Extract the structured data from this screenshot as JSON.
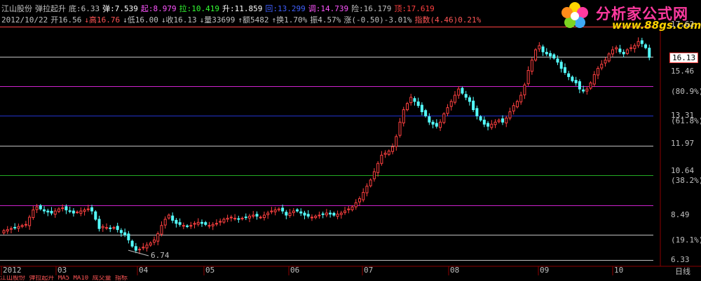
{
  "header": {
    "line1": [
      {
        "text": "江山股份",
        "color": "#c0c0c0"
      },
      {
        "text": "弹拉起升",
        "color": "#c0c0c0"
      },
      {
        "text": "底:6.33",
        "color": "#c0c0c0"
      },
      {
        "text": "弹:7.539",
        "color": "#ffffff"
      },
      {
        "text": "起:8.979",
        "color": "#ff55ff"
      },
      {
        "text": "拉:10.419",
        "color": "#33ff33"
      },
      {
        "text": "升:11.859",
        "color": "#ffffff"
      },
      {
        "text": "回:13.299",
        "color": "#4060ff"
      },
      {
        "text": "调:14.739",
        "color": "#ff55ff"
      },
      {
        "text": "险:16.179",
        "color": "#c0c0c0"
      },
      {
        "text": "顶:17.619",
        "color": "#ff4040"
      }
    ],
    "line2": [
      {
        "text": "2012/10/22",
        "color": "#c0c0c0"
      },
      {
        "text": "开16.56",
        "color": "#c0c0c0"
      },
      {
        "text": "↓高16.76",
        "color": "#ff5555"
      },
      {
        "text": "↓低16.00",
        "color": "#c0c0c0"
      },
      {
        "text": "↓收16.13",
        "color": "#c0c0c0"
      },
      {
        "text": "↓量33699",
        "color": "#c0c0c0"
      },
      {
        "text": "↑额5482",
        "color": "#c0c0c0"
      },
      {
        "text": "↑换1.70%",
        "color": "#c0c0c0"
      },
      {
        "text": "振4.57%",
        "color": "#c0c0c0"
      },
      {
        "text": "涨(-0.50)-3.01%",
        "color": "#c0c0c0"
      },
      {
        "text": "指数(4.46)0.21%",
        "color": "#ff5555"
      }
    ]
  },
  "logo": {
    "title": "分析家公式网",
    "site": "www.88gs.com"
  },
  "price_axis": [
    {
      "label": "17.62",
      "color": "#c0c0c0"
    },
    {
      "label": "16.13",
      "color": "#ffffff",
      "highlight": true
    },
    {
      "label": "15.46",
      "color": "#c0c0c0"
    },
    {
      "label": "(80.9%)",
      "color": "#c0c0c0"
    },
    {
      "label": "13.31",
      "color": "#c0c0c0"
    },
    {
      "label": "(61.8%)",
      "color": "#c0c0c0"
    },
    {
      "label": "11.97",
      "color": "#c0c0c0"
    },
    {
      "label": "10.64",
      "color": "#c0c0c0"
    },
    {
      "label": "(38.2%)",
      "color": "#c0c0c0"
    },
    {
      "label": "8.49",
      "color": "#c0c0c0"
    },
    {
      "label": "(19.1%)",
      "color": "#c0c0c0"
    },
    {
      "label": "6.33",
      "color": "#c0c0c0"
    }
  ],
  "levels": [
    {
      "name": "顶",
      "value": 17.619,
      "color": "#ff4040"
    },
    {
      "name": "险",
      "value": 16.179,
      "color": "#c0c0c0"
    },
    {
      "name": "调",
      "value": 14.739,
      "color": "#cc22cc"
    },
    {
      "name": "回",
      "value": 13.299,
      "color": "#2233cc"
    },
    {
      "name": "升",
      "value": 11.859,
      "color": "#c0c0c0"
    },
    {
      "name": "拉",
      "value": 10.419,
      "color": "#22aa22"
    },
    {
      "name": "起",
      "value": 8.979,
      "color": "#cc22cc"
    },
    {
      "name": "弹",
      "value": 7.539,
      "color": "#c0c0c0"
    },
    {
      "name": "底",
      "value": 6.33,
      "color": "#c0c0c0"
    }
  ],
  "low_marker": "6.74",
  "x_axis": {
    "ticks": [
      "2012",
      "03",
      "04",
      "05",
      "06",
      "07",
      "08",
      "09",
      "10"
    ],
    "period": "日线"
  },
  "chart_data": {
    "type": "candlestick",
    "y_range": [
      6.33,
      17.62
    ],
    "close": [
      7.75,
      7.8,
      7.85,
      7.9,
      7.95,
      8.0,
      8.05,
      8.4,
      8.75,
      8.9,
      8.8,
      8.7,
      8.65,
      8.6,
      8.7,
      8.8,
      8.85,
      8.75,
      8.7,
      8.6,
      8.65,
      8.7,
      8.75,
      8.8,
      8.7,
      8.3,
      7.85,
      7.95,
      7.9,
      7.85,
      7.9,
      7.8,
      7.65,
      7.55,
      7.3,
      7.0,
      6.8,
      6.85,
      6.95,
      7.05,
      7.15,
      7.3,
      7.6,
      8.0,
      8.3,
      8.5,
      8.25,
      8.1,
      8.05,
      8.0,
      7.95,
      8.0,
      8.1,
      8.15,
      8.1,
      8.05,
      8.0,
      8.05,
      8.1,
      8.2,
      8.3,
      8.35,
      8.4,
      8.35,
      8.3,
      8.35,
      8.4,
      8.45,
      8.5,
      8.45,
      8.4,
      8.5,
      8.6,
      8.7,
      8.75,
      8.8,
      8.7,
      8.5,
      8.6,
      8.7,
      8.7,
      8.6,
      8.5,
      8.45,
      8.4,
      8.45,
      8.5,
      8.55,
      8.6,
      8.55,
      8.5,
      8.55,
      8.6,
      8.7,
      8.8,
      8.9,
      9.1,
      9.3,
      9.6,
      9.9,
      10.2,
      10.6,
      11.0,
      11.4,
      11.5,
      11.6,
      11.8,
      12.3,
      13.0,
      13.6,
      13.9,
      14.2,
      14.0,
      13.8,
      13.5,
      13.3,
      13.0,
      12.9,
      12.8,
      13.0,
      13.4,
      13.7,
      14.0,
      14.3,
      14.6,
      14.4,
      14.2,
      14.0,
      13.6,
      13.3,
      13.1,
      12.9,
      12.8,
      12.9,
      13.0,
      13.1,
      13.0,
      13.2,
      13.5,
      13.8,
      14.0,
      14.3,
      14.8,
      15.5,
      16.0,
      16.5,
      16.7,
      16.4,
      16.3,
      16.2,
      16.1,
      15.9,
      15.6,
      15.4,
      15.2,
      15.0,
      14.9,
      14.6,
      14.5,
      14.6,
      14.9,
      15.3,
      15.6,
      15.8,
      16.0,
      16.3,
      16.5,
      16.6,
      16.4,
      16.3,
      16.5,
      16.6,
      16.7,
      16.9,
      16.8,
      16.6,
      16.13
    ]
  },
  "bottom_bar": "江山股份 弹拉起升 MA5 MA10 成交量 指标"
}
